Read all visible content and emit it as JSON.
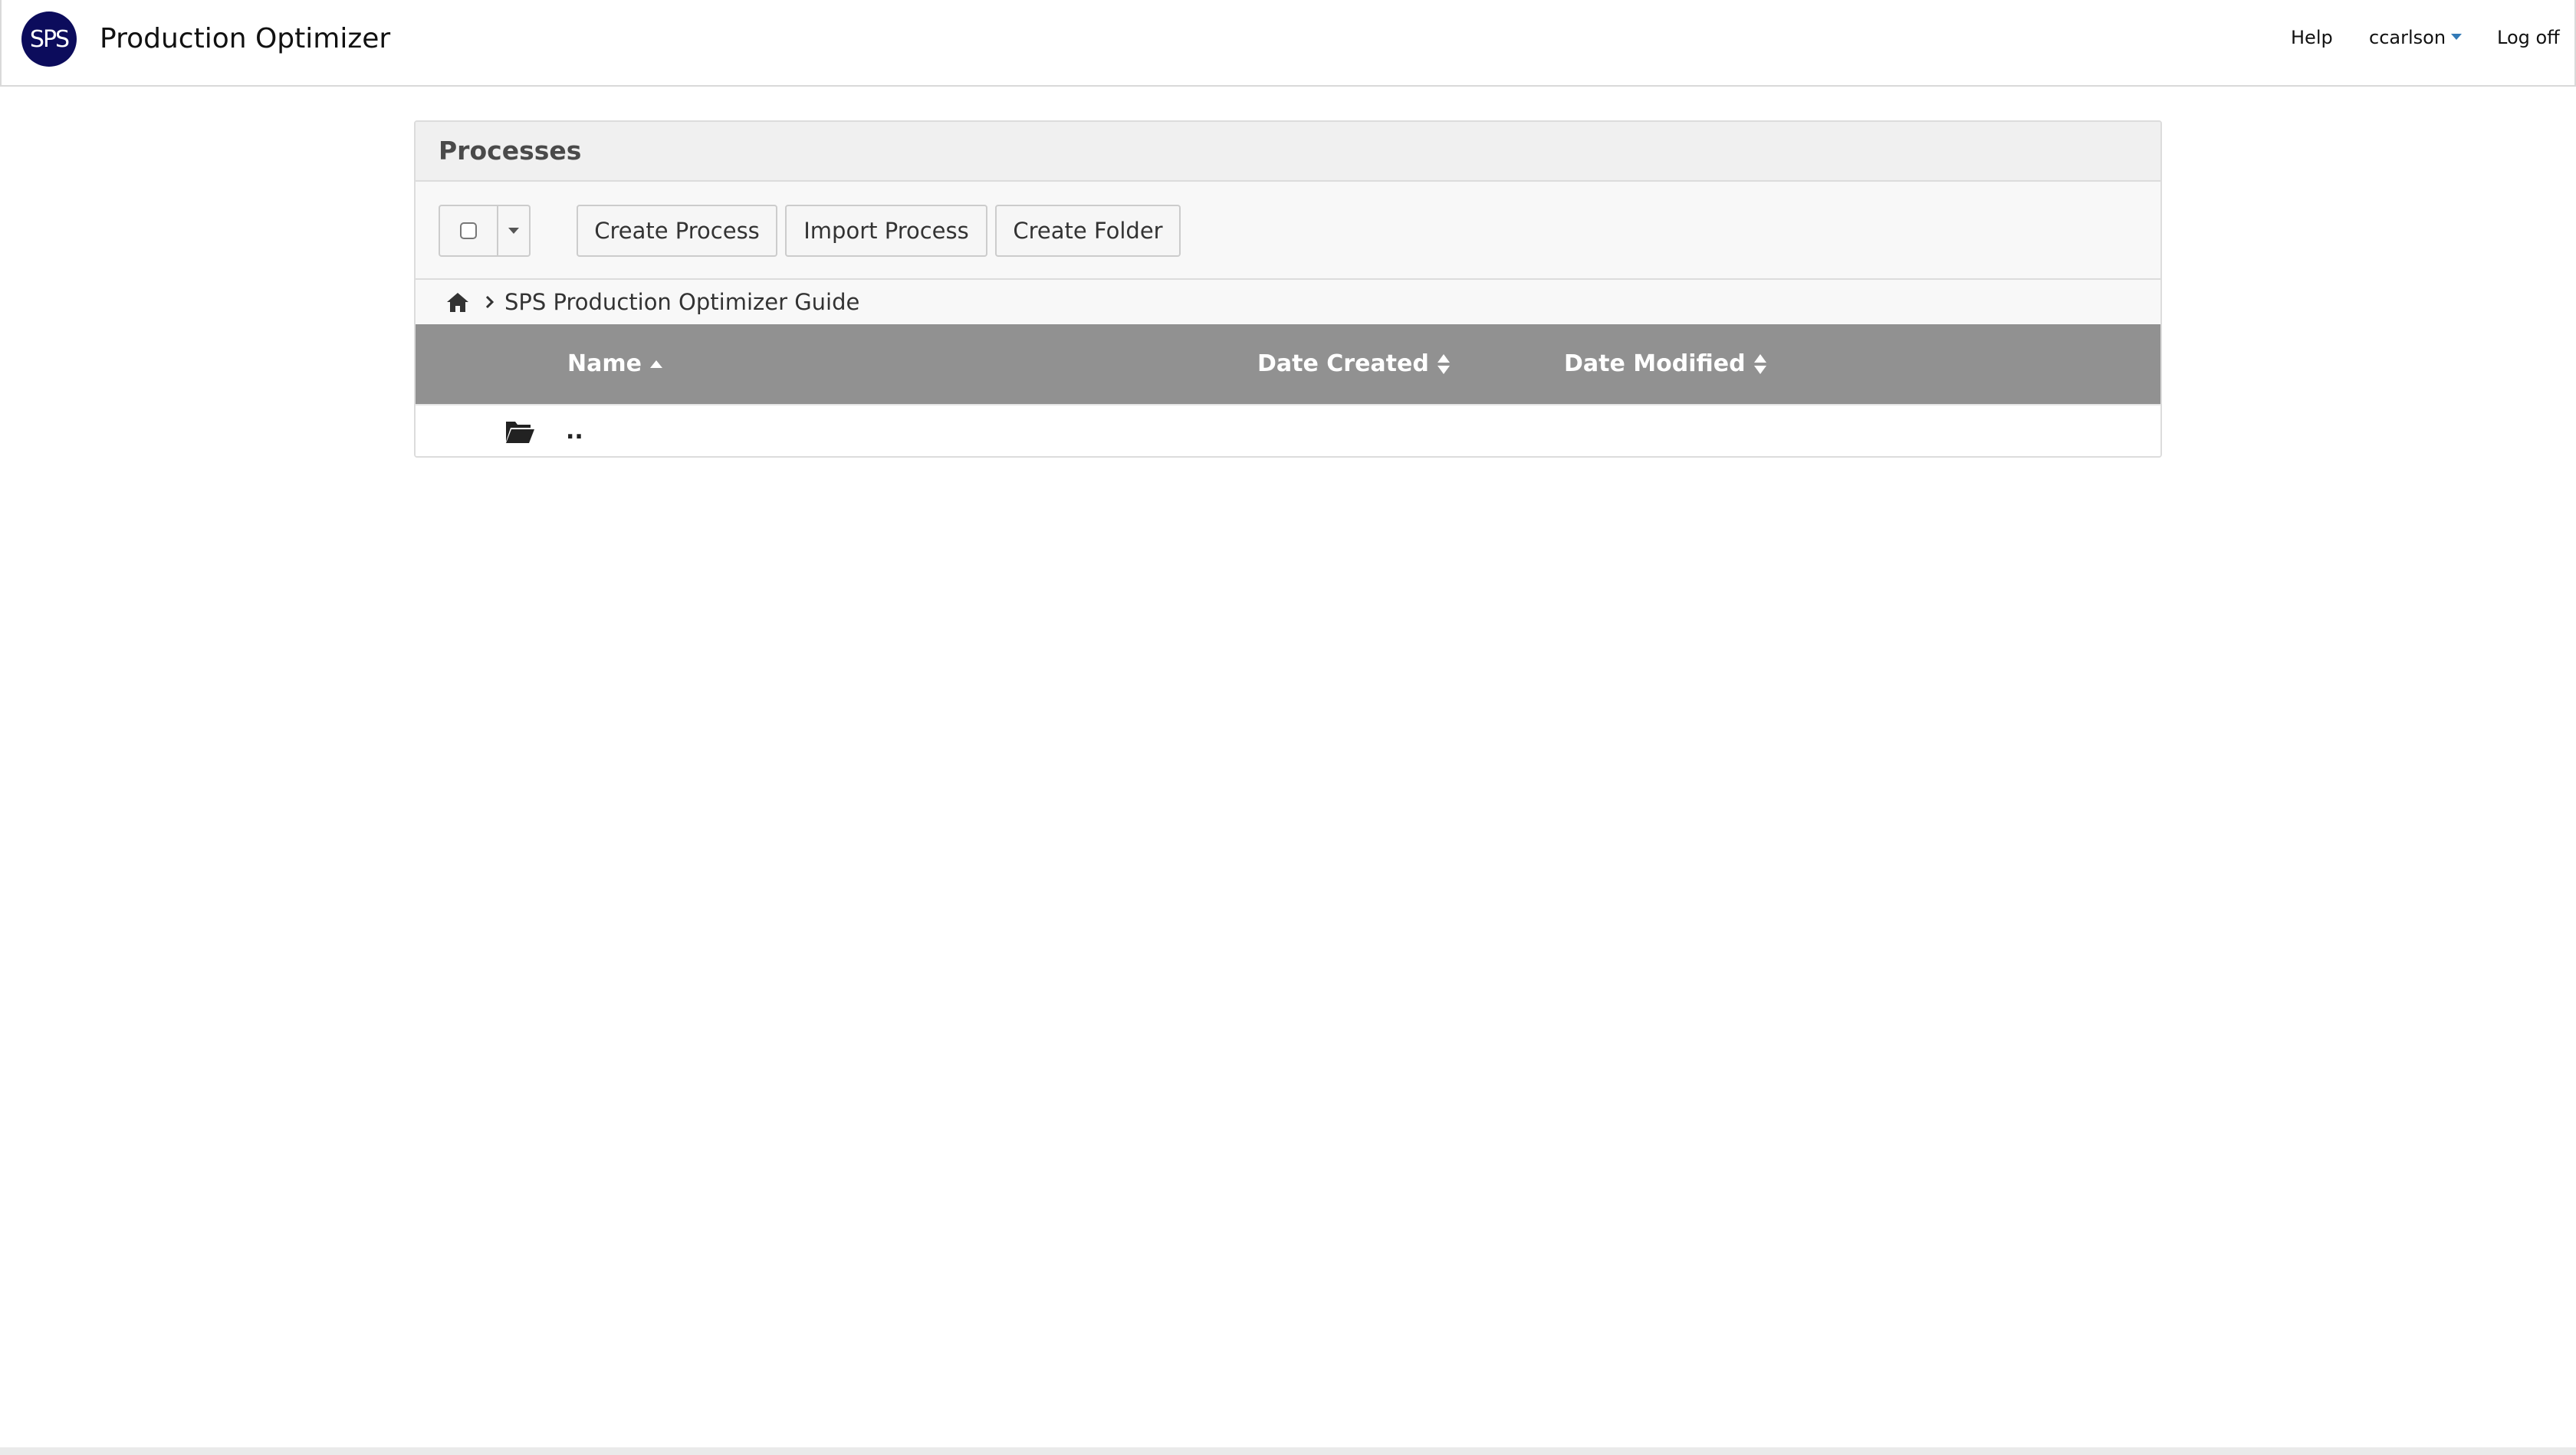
{
  "app": {
    "logo_text": "SPS",
    "title": "Production Optimizer"
  },
  "nav": {
    "help": "Help",
    "user": "ccarlson",
    "logoff": "Log off"
  },
  "panel": {
    "title": "Processes",
    "toolbar": {
      "create_process": "Create Process",
      "import_process": "Import Process",
      "create_folder": "Create Folder"
    },
    "breadcrumb": {
      "home_icon": "home-icon",
      "items": [
        "SPS Production Optimizer Guide"
      ]
    },
    "table": {
      "columns": [
        {
          "label": "Name",
          "sort": "ascending"
        },
        {
          "label": "Date Created",
          "sort": "none"
        },
        {
          "label": "Date Modified",
          "sort": "none"
        }
      ],
      "rows": [
        {
          "icon": "folder-open-icon",
          "name": "..",
          "date_created": "",
          "date_modified": ""
        }
      ]
    }
  },
  "colors": {
    "logo_bg": "#0c0c5c",
    "table_header_bg": "#919191",
    "panel_heading_bg": "#f0f0f0",
    "user_caret": "#337ab7"
  }
}
